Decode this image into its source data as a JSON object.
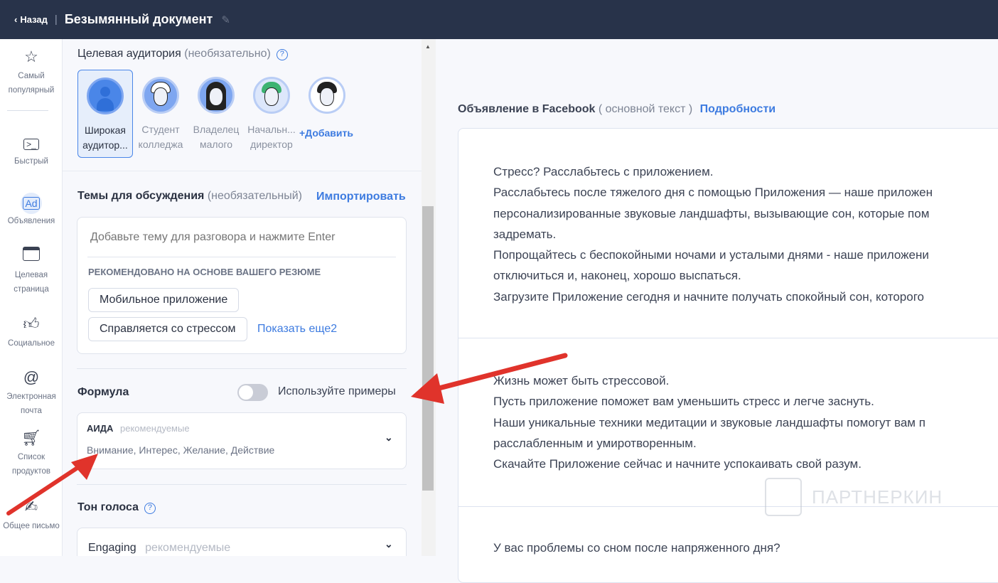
{
  "header": {
    "back_label": "Назад",
    "doc_title": "Безымянный документ"
  },
  "sidebar": {
    "items": [
      {
        "label": "Самый популярный",
        "icon": "star-icon"
      },
      {
        "label": "Быстрый",
        "icon": "terminal-icon"
      },
      {
        "label": "Объявления",
        "icon": "ad-icon",
        "active": true,
        "icon_text": "Ad"
      },
      {
        "label": "Целевая страница",
        "icon": "browser-window-icon"
      },
      {
        "label": "Социальное",
        "icon": "thumbs-up-icon"
      },
      {
        "label": "Электронная почта",
        "icon": "at-icon"
      },
      {
        "label": "Список продуктов",
        "icon": "cart-icon"
      },
      {
        "label": "Общее письмо",
        "icon": "pen-icon"
      }
    ]
  },
  "form": {
    "audience": {
      "label": "Целевая аудитория",
      "optional": "(необязательно)",
      "items": [
        {
          "line1": "Широкая",
          "line2": "аудитор...",
          "selected": true
        },
        {
          "line1": "Студент",
          "line2": "колледжа"
        },
        {
          "line1": "Владелец",
          "line2": "малого"
        },
        {
          "line1": "Начальн...",
          "line2": "директор"
        }
      ],
      "add_label": "+Добавить"
    },
    "topics": {
      "label": "Темы для обсуждения",
      "optional": "(необязательный)",
      "import_label": "Импортировать",
      "placeholder": "Добавьте тему для разговора и нажмите Enter",
      "recommended_heading": "РЕКОМЕНДОВАНО НА ОСНОВЕ ВАШЕГО РЕЗЮМЕ",
      "chips": [
        "Мобильное приложение",
        "Справляется со стрессом"
      ],
      "show_more": "Показать еще2"
    },
    "formula": {
      "label": "Формула",
      "toggle_label": "Используйте примеры",
      "toggle_on": false,
      "selected": "АИДА",
      "tag": "рекомендуемые",
      "description": "Внимание, Интерес, Желание, Действие"
    },
    "tone": {
      "label": "Тон голоса",
      "selected": "Engaging",
      "tag": "рекомендуемые"
    }
  },
  "output": {
    "heading": "Объявление в Facebook",
    "subheading": "( основной текст )",
    "details_link": "Подробности",
    "variants": [
      [
        "Стресс? Расслабьтесь с приложением.",
        "Расслабьтесь после тяжелого дня с помощью Приложения — наше приложен",
        "персонализированные звуковые ландшафты, вызывающие сон, которые пом",
        "задремать.",
        "Попрощайтесь с беспокойными ночами и усталыми днями - наше приложени",
        "отключиться и, наконец, хорошо выспаться.",
        "Загрузите Приложение сегодня и начните получать спокойный сон, которого"
      ],
      [
        "Жизнь может быть стрессовой.",
        "Пусть приложение поможет вам уменьшить стресс и легче заснуть.",
        "Наши уникальные техники медитации и звуковые ландшафты помогут вам п",
        "расслабленным и умиротворенным.",
        "Скачайте Приложение сейчас и начните успокаивать свой разум."
      ],
      [
        "У вас проблемы со сном после напряженного дня?"
      ]
    ]
  },
  "watermark": "ПАРТНЕРКИН",
  "colors": {
    "header": "#28334a",
    "accent": "#3d7be0",
    "annotation_arrow": "#e0332b"
  }
}
